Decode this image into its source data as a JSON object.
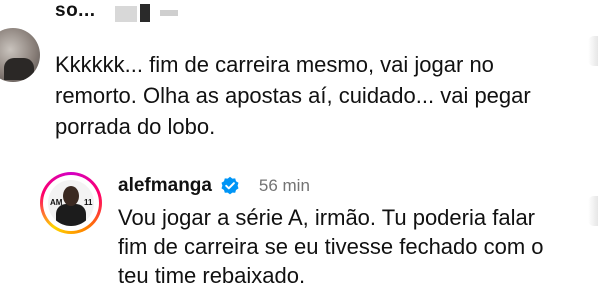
{
  "top_comment": {
    "username": "so...",
    "text": "Kkkkkk... fim de carreira mesmo, vai jogar no remorto. Olha as apostas aí, cuidado... vai pegar porrada do lobo."
  },
  "reply": {
    "username": "alefmanga",
    "verified": true,
    "timestamp": "56 min",
    "text": "Vou jogar a série A, irmão. Tu poderia falar fim de carreira se eu tivesse fechado com o teu time rebaixado.",
    "avatar_text_left": "AM",
    "avatar_text_right": "11"
  },
  "colors": {
    "verified_badge": "#0095f6",
    "timestamp": "#737373"
  }
}
